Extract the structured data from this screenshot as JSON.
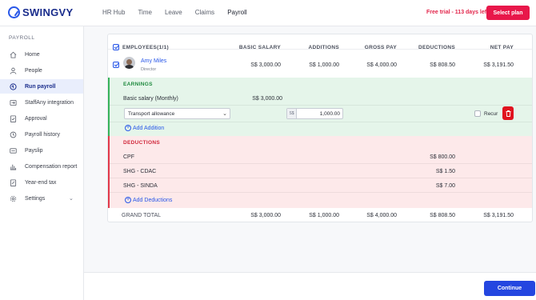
{
  "brand": {
    "name": "SWINGVY"
  },
  "topnav": {
    "items": [
      "HR Hub",
      "Time",
      "Leave",
      "Claims",
      "Payroll"
    ],
    "active": "Payroll"
  },
  "trial": {
    "text": "Free trial - 113 days left",
    "button": "Select plan"
  },
  "sidebar": {
    "heading": "PAYROLL",
    "items": [
      {
        "label": "Home",
        "icon": "home-icon"
      },
      {
        "label": "People",
        "icon": "people-icon"
      },
      {
        "label": "Run payroll",
        "icon": "run-payroll-icon",
        "active": true
      },
      {
        "label": "StaffAny integration",
        "icon": "integration-icon"
      },
      {
        "label": "Approval",
        "icon": "approval-icon"
      },
      {
        "label": "Payroll history",
        "icon": "history-icon"
      },
      {
        "label": "Payslip",
        "icon": "payslip-icon"
      },
      {
        "label": "Compensation report",
        "icon": "report-icon"
      },
      {
        "label": "Year-end tax",
        "icon": "tax-icon"
      },
      {
        "label": "Settings",
        "icon": "gear-icon"
      }
    ]
  },
  "table": {
    "headers": {
      "employees": "EMPLOYEES(1/1)",
      "basic_salary": "BASIC SALARY",
      "additions": "ADDITIONS",
      "gross_pay": "GROSS PAY",
      "deductions": "DEDUCTIONS",
      "net_pay": "NET PAY"
    },
    "employee": {
      "name": "Amy Miles",
      "role": "Director",
      "basic_salary": "S$ 3,000.00",
      "additions": "S$ 1,000.00",
      "gross_pay": "S$ 4,000.00",
      "deductions": "S$ 808.50",
      "net_pay": "S$ 3,191.50"
    },
    "earnings": {
      "title": "EARNINGS",
      "basic_label": "Basic salary (Monthly)",
      "basic_value": "S$ 3,000.00",
      "allowance_select": "Transport allowance",
      "currency_prefix": "S$",
      "allowance_amount": "1,000.00",
      "recur_label": "Recur",
      "add_label": "Add Addition"
    },
    "deductions": {
      "title": "DEDUCTIONS",
      "items": [
        {
          "label": "CPF",
          "value": "S$ 800.00"
        },
        {
          "label": "SHG - CDAC",
          "value": "S$ 1.50"
        },
        {
          "label": "SHG - SINDA",
          "value": "S$ 7.00"
        }
      ],
      "add_label": "Add Deductions"
    },
    "grand_total": {
      "label": "GRAND TOTAL",
      "basic_salary": "S$ 3,000.00",
      "additions": "S$ 1,000.00",
      "gross_pay": "S$ 4,000.00",
      "deductions": "S$ 808.50",
      "net_pay": "S$ 3,191.50"
    }
  },
  "footer": {
    "continue_label": "Continue"
  },
  "colors": {
    "accent": "#2446e0",
    "brand_pink": "#e8174a",
    "earnings_bg": "#e5f5ea",
    "deductions_bg": "#fde9ea"
  }
}
